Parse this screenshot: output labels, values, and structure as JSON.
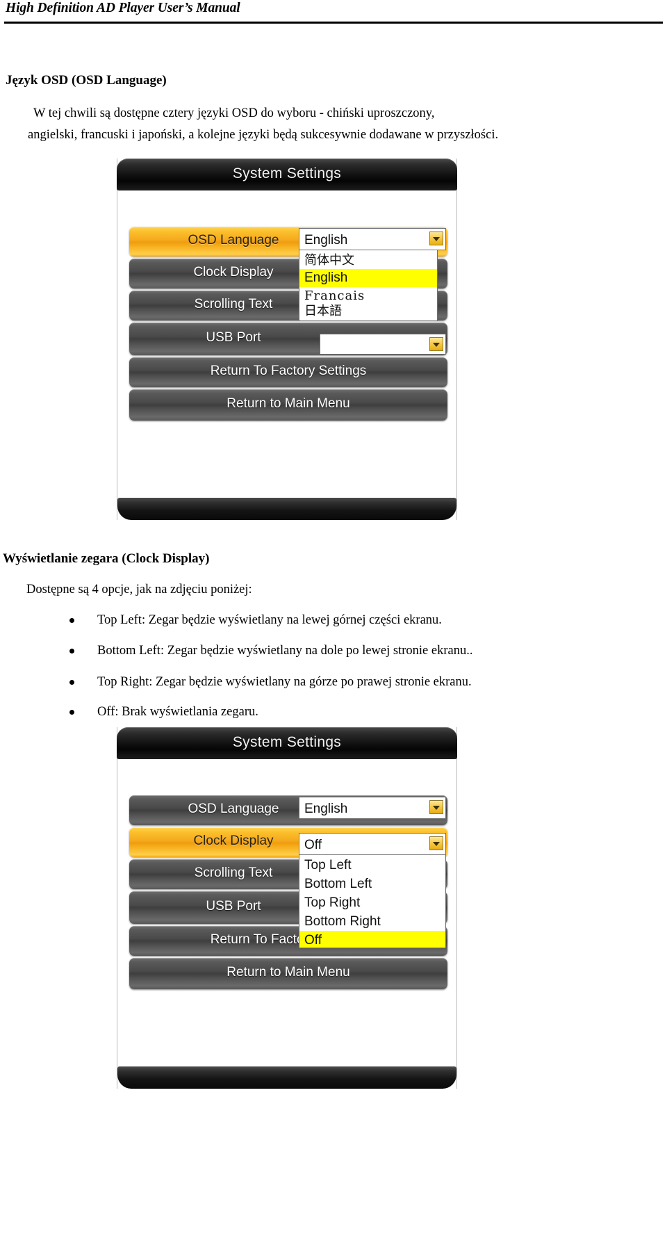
{
  "header": {
    "title": "High Definition AD Player User’s Manual"
  },
  "sections": {
    "osd_language": {
      "heading": "Język OSD (OSD Language)",
      "paragraph_lines": [
        "W tej chwili są dostępne cztery języki OSD    do wyboru - chiński uproszczony,",
        "angielski, francuski i japoński, a kolejne języki będą sukcesywnie dodawane w przyszłości."
      ]
    },
    "clock_display": {
      "heading": "Wyświetlanie zegara (Clock Display)",
      "intro": "Dostępne są 4 opcje, jak na zdjęciu poniżej:",
      "bullets": [
        "Top Left: Zegar będzie wyświetlany na lewej górnej części ekranu.",
        "Bottom Left: Zegar będzie wyświetlany na dole po lewej stronie ekranu..",
        "Top Right: Zegar będzie wyświetlany na górze po prawej stronie ekranu.",
        "Off: Brak wyświetlania zegaru."
      ]
    }
  },
  "osd_screen_1": {
    "title": "System Settings",
    "menu": [
      {
        "label": "OSD Language",
        "state": "active"
      },
      {
        "label": "Clock Display",
        "state": "normal"
      },
      {
        "label": "Scrolling Text",
        "state": "normal"
      },
      {
        "label": "USB Port",
        "state": "normal"
      },
      {
        "label": "Return To Factory Settings",
        "state": "normal"
      },
      {
        "label": "Return to Main Menu",
        "state": "normal"
      }
    ],
    "language_field": {
      "value": "English",
      "options": [
        {
          "label": "简体中文",
          "selected": false,
          "script": "cjk"
        },
        {
          "label": "English",
          "selected": true,
          "script": "latin"
        },
        {
          "label": "Francais",
          "selected": false,
          "script": "serif"
        },
        {
          "label": "日本語",
          "selected": false,
          "script": "cjk"
        }
      ]
    },
    "usb_field": {
      "value": ""
    }
  },
  "osd_screen_2": {
    "title": "System Settings",
    "menu": [
      {
        "label": "OSD Language",
        "state": "normal"
      },
      {
        "label": "Clock Display",
        "state": "active"
      },
      {
        "label": "Scrolling Text",
        "state": "normal"
      },
      {
        "label": "USB Port",
        "state": "normal"
      },
      {
        "label": "Return To Factory Settings",
        "state": "normal"
      },
      {
        "label": "Return to Main Menu",
        "state": "normal"
      }
    ],
    "language_field": {
      "value": "English"
    },
    "clock_field": {
      "value": "Off",
      "options": [
        {
          "label": "Top Left",
          "selected": false
        },
        {
          "label": "Bottom Left",
          "selected": false
        },
        {
          "label": "Top Right",
          "selected": false
        },
        {
          "label": "Bottom Right",
          "selected": false
        },
        {
          "label": "Off",
          "selected": true
        }
      ]
    }
  },
  "colors": {
    "accent_orange": "#f5a81c",
    "highlight_yellow": "#ffff00",
    "panel_dark": "#111111",
    "button_grey": "#4a4a4a"
  },
  "icons": {
    "dropdown_arrow": "chevron-down-icon",
    "bullet": "bullet-dot-icon"
  }
}
